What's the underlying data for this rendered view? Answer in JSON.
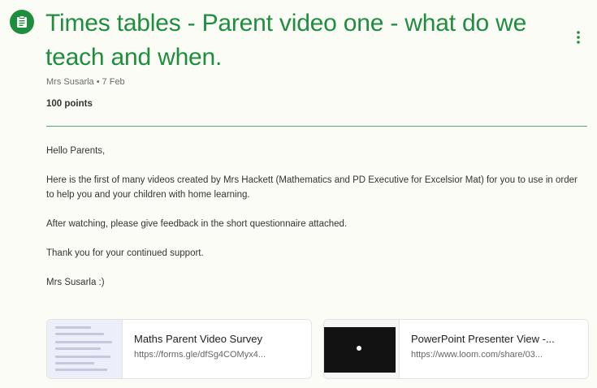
{
  "assignment": {
    "icon": "assignment-icon",
    "title": "Times tables - Parent video one - what do we teach and when.",
    "author": "Mrs Susarla",
    "date": "7 Feb",
    "points": "100 points",
    "more_icon": "more-vert-icon"
  },
  "colors": {
    "accent": "#1e8e3e",
    "background": "#fcfcf7"
  },
  "body": {
    "greeting": "Hello Parents,",
    "paragraph1": "Here is the first of many videos created by Mrs Hackett (Mathematics and PD Executive for Excelsior Mat) for you to use in order to help you and your children with home learning.",
    "paragraph2": "After watching, please give feedback in the short questionnaire attached.",
    "paragraph3": "Thank you for your continued support.",
    "signoff": "Mrs Susarla :)"
  },
  "attachments": [
    {
      "title": "Maths Parent Video Survey",
      "url": "https://forms.gle/dfSg4COMyx4..."
    },
    {
      "title": "PowerPoint Presenter View -...",
      "url": "https://www.loom.com/share/03..."
    }
  ]
}
